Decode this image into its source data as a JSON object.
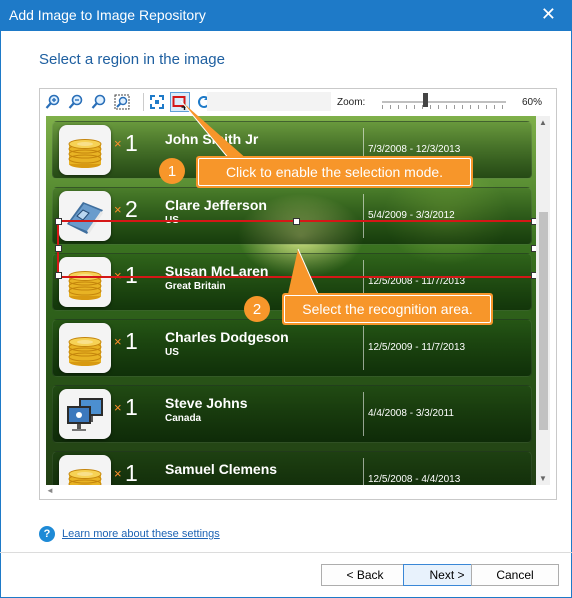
{
  "window": {
    "title": "Add Image to Image Repository",
    "close_symbol": "✕"
  },
  "heading": "Select a region in the image",
  "toolbar": {
    "icons": [
      "zoom-in-icon",
      "zoom-out-icon",
      "zoom-fit-icon",
      "zoom-region-icon",
      "fit-page-icon",
      "select-region-icon",
      "refresh-icon"
    ],
    "zoom_label": "Zoom:",
    "zoom_value": "60%",
    "zoom_level_percent": 60
  },
  "cards": [
    {
      "name": "John Smith Jr",
      "country": "",
      "quantity": "1",
      "times": "×",
      "dates": "7/3/2008 - 12/3/2013",
      "icon": "coins-icon"
    },
    {
      "name": "Clare Jefferson",
      "country": "US",
      "quantity": "2",
      "times": "×",
      "dates": "5/4/2009 - 3/3/2012",
      "icon": "book-icon"
    },
    {
      "name": "Susan McLaren",
      "country": "Great Britain",
      "quantity": "1",
      "times": "×",
      "dates": "12/5/2008 - 11/7/2013",
      "icon": "coins-icon"
    },
    {
      "name": "Charles Dodgeson",
      "country": "US",
      "quantity": "1",
      "times": "×",
      "dates": "12/5/2009 - 11/7/2013",
      "icon": "coins-icon"
    },
    {
      "name": "Steve Johns",
      "country": "Canada",
      "quantity": "1",
      "times": "×",
      "dates": "4/4/2008 - 3/3/2011",
      "icon": "monitors-icon"
    },
    {
      "name": "Samuel Clemens",
      "country": "",
      "quantity": "1",
      "times": "×",
      "dates": "12/5/2008 - 4/4/2013",
      "icon": "coins-icon"
    }
  ],
  "callouts": [
    {
      "number": "1",
      "text": "Click to enable the selection mode."
    },
    {
      "number": "2",
      "text": "Select the recognition area."
    }
  ],
  "help_link": "Learn more about these settings",
  "help_icon_symbol": "?",
  "buttons": {
    "back": "< Back",
    "next": "Next >",
    "cancel": "Cancel"
  },
  "colors": {
    "titlebar": "#1e7ac8",
    "accent": "#f7962a",
    "selection": "#d51717"
  }
}
